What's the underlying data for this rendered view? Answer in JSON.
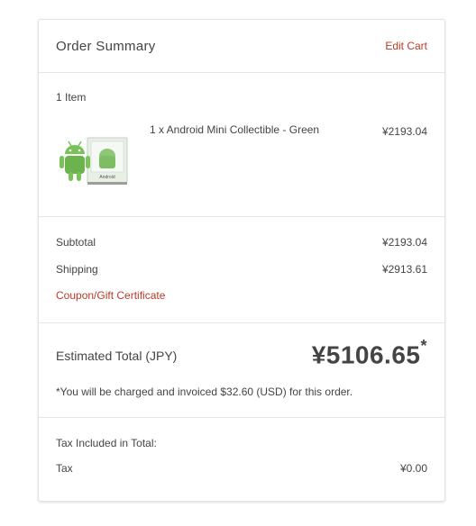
{
  "header": {
    "title": "Order Summary",
    "edit_cart": "Edit Cart"
  },
  "items": {
    "count_label": "1 Item",
    "list": [
      {
        "name": "1 x Android Mini Collectible - Green",
        "price": "¥2193.04",
        "image_icon": "android-figure-with-box",
        "box_label": "Android"
      }
    ]
  },
  "totals": {
    "subtotal_label": "Subtotal",
    "subtotal_value": "¥2193.04",
    "shipping_label": "Shipping",
    "shipping_value": "¥2913.61",
    "coupon_link": "Coupon/Gift Certificate"
  },
  "estimated": {
    "label": "Estimated Total (JPY)",
    "amount": "¥5106.65",
    "asterisk": "*",
    "note": "*You will be charged and invoiced $32.60 (USD) for this order."
  },
  "tax": {
    "included_label": "Tax Included in Total:",
    "tax_label": "Tax",
    "tax_value": "¥0.00"
  },
  "colors": {
    "link": "#b83b2b",
    "android_green": "#78c257"
  }
}
